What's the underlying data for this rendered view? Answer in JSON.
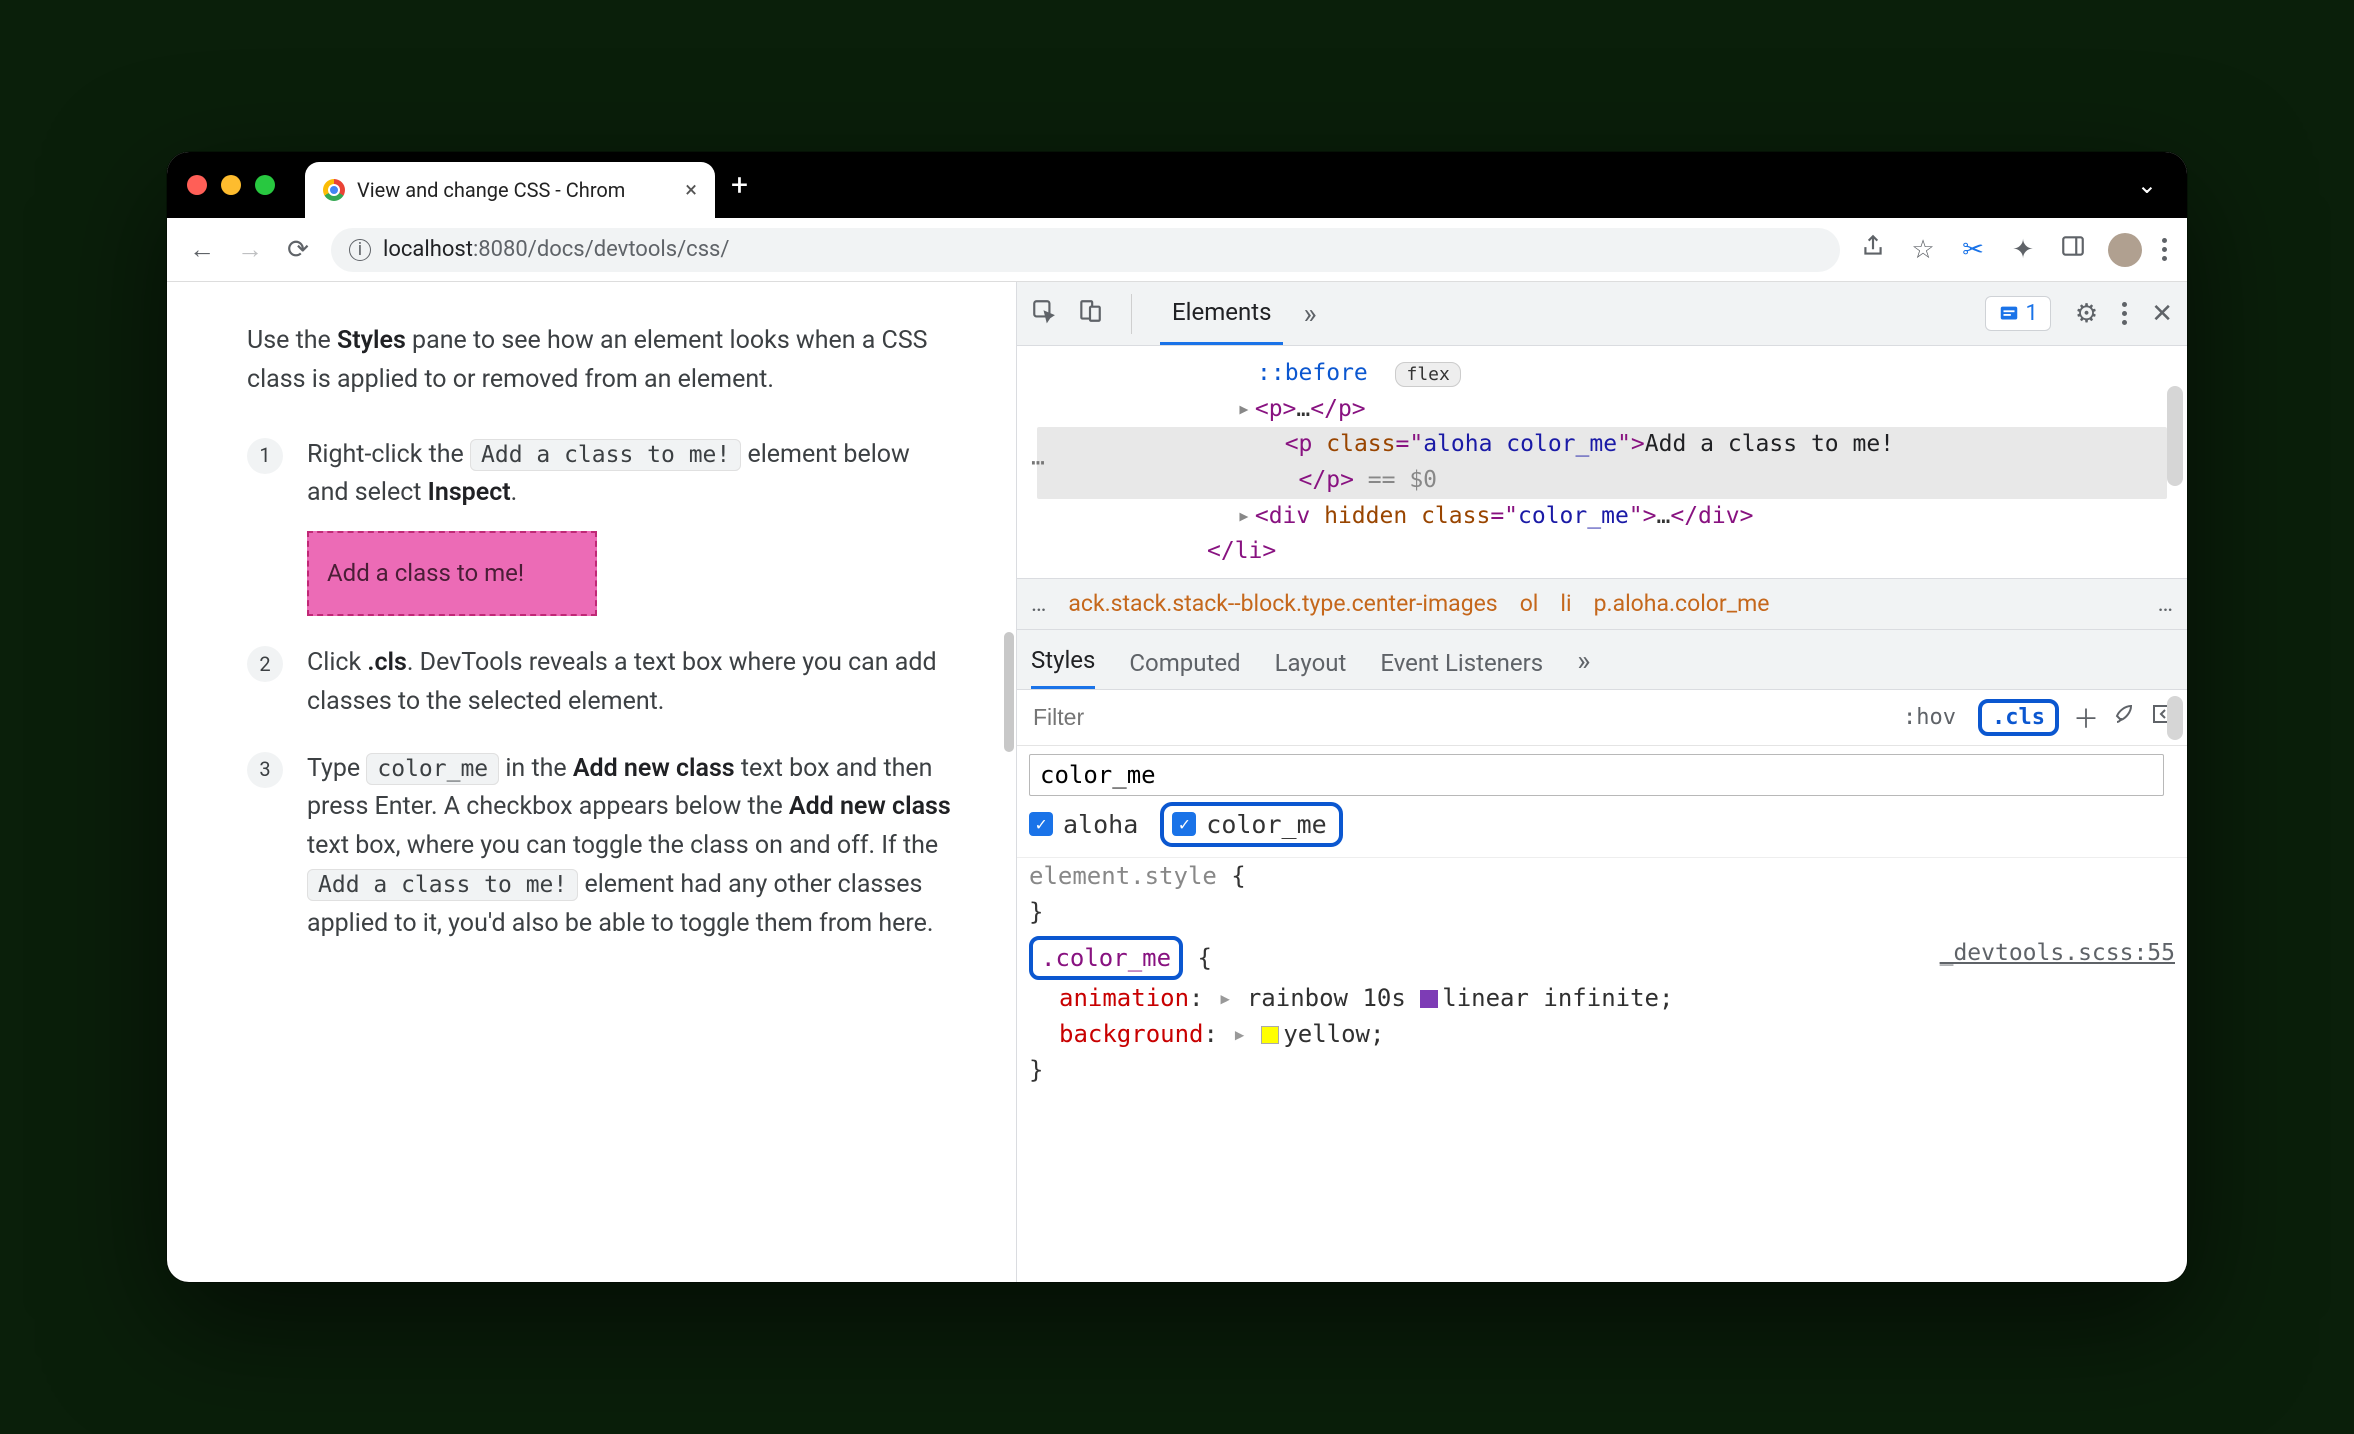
{
  "tab": {
    "title": "View and change CSS - Chrom"
  },
  "toolbar": {
    "url_host": "localhost",
    "url_port": ":8080",
    "url_path": "/docs/devtools/css/"
  },
  "page": {
    "intro_pre": "Use the ",
    "intro_b1": "Styles",
    "intro_post": " pane to see how an element looks when a CSS class is applied to or removed from an element.",
    "steps": [
      {
        "n": "1",
        "t1": "Right-click the ",
        "code1": "Add a class to me!",
        "t2": " element below and select ",
        "b1": "Inspect",
        "t3": ".",
        "demo": "Add a class to me!"
      },
      {
        "n": "2",
        "t1": "Click ",
        "b1": ".cls",
        "t2": ". DevTools reveals a text box where you can add classes to the selected element."
      },
      {
        "n": "3",
        "t1": "Type ",
        "code1": "color_me",
        "t2": " in the ",
        "b1": "Add new class",
        "t3": " text box and then press Enter. A checkbox appears below the ",
        "b2": "Add new class",
        "t4": " text box, where you can toggle the class on and off. If the ",
        "code2": "Add a class to me!",
        "t5": " element had any other classes applied to it, you'd also be able to toggle them from here."
      }
    ]
  },
  "devtools": {
    "tabs": {
      "elements": "Elements"
    },
    "issues_count": "1",
    "dom": {
      "before": "::before",
      "before_pill": "flex",
      "p1_open": "<p>",
      "p1_ell": "…",
      "p1_close": "</p>",
      "sel_open1": "<p ",
      "sel_attr": "class",
      "sel_eq": "=\"",
      "sel_val": "aloha color_me",
      "sel_open2": "\">",
      "sel_text": "Add a class to me!",
      "sel_close": "</p>",
      "sel_eq0": " == $0",
      "div_open1": "<div ",
      "div_attr1": "hidden",
      "div_attr2": "class",
      "div_val": "color_me",
      "div_open2": "\">",
      "div_ell": "…",
      "div_close": "</div>",
      "li_close": "</li>"
    },
    "crumbs": {
      "c1": "ack.stack.stack--block.type.center-images",
      "c2": "ol",
      "c3": "li",
      "c4": "p.aloha.color_me"
    },
    "subtabs": {
      "styles": "Styles",
      "computed": "Computed",
      "layout": "Layout",
      "listeners": "Event Listeners"
    },
    "filter": {
      "placeholder": "Filter",
      "hov": ":hov",
      "cls": ".cls"
    },
    "addclass": {
      "value": "color_me",
      "chk1": "aloha",
      "chk2": "color_me"
    },
    "rules": {
      "es_sel": "element.style",
      "r_sel": ".color_me",
      "r_src": "_devtools.scss:55",
      "p1": "animation",
      "v1": "rainbow 10s ",
      "v1b": "linear infinite;",
      "p2": "background",
      "v2": "yellow;"
    }
  }
}
